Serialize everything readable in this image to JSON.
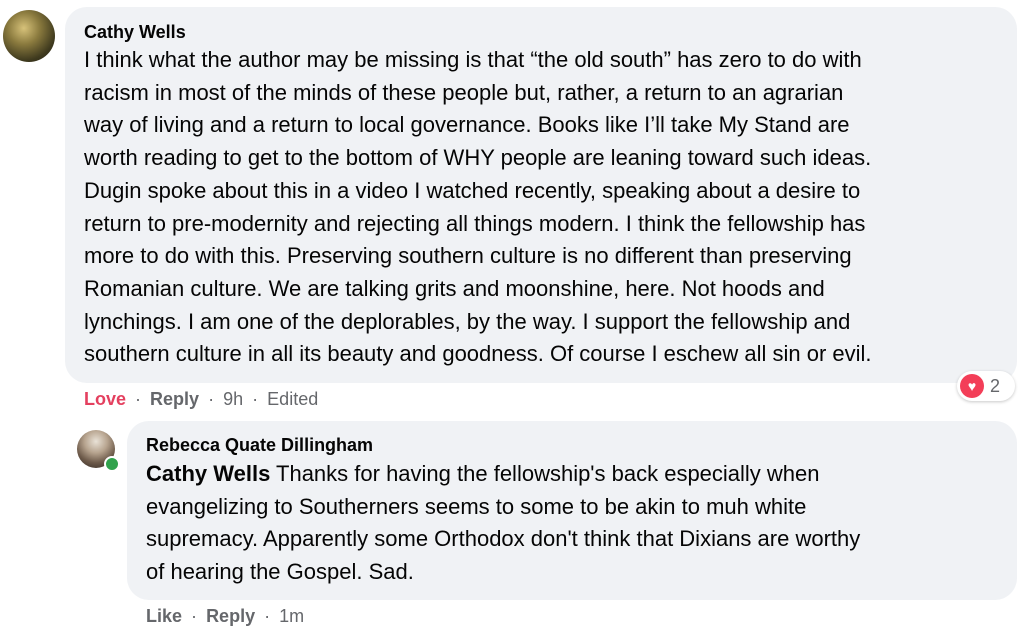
{
  "comment": {
    "author": "Cathy Wells",
    "lines": [
      "I think what the author may be missing is that “the old south” has zero to do with",
      "racism in most of the minds of these people but, rather, a return to an agrarian",
      "way of living and a return to local governance. Books like I’ll take My Stand are",
      "worth reading to get to the bottom of WHY people are leaning toward such ideas.",
      "Dugin spoke about this in a video I watched recently, speaking about a desire to",
      "return to pre-modernity and rejecting all things modern. I think the fellowship has",
      "more to do with this. Preserving southern culture is no different than preserving",
      "Romanian culture. We are talking grits and moonshine, here. Not hoods and",
      "lynchings. I am one of the deplorables, by the way. I support the fellowship and",
      "southern culture in all its beauty and goodness. Of course I eschew all sin or evil."
    ],
    "actions": {
      "love": "Love",
      "reply": "Reply",
      "time": "9h",
      "edited": "Edited",
      "separator": "·"
    },
    "reactions": {
      "icon": "heart-icon",
      "count": "2",
      "color": "#f33e58"
    }
  },
  "reply": {
    "author": "Rebecca Quate Dillingham",
    "mention": "Cathy Wells",
    "lines": [
      " Thanks for having the fellowship's back especially when",
      "evangelizing to Southerners seems to some to be akin to muh white",
      "supremacy. Apparently some Orthodox don't think that Dixians are worthy",
      "of hearing the Gospel. Sad."
    ],
    "online": true,
    "actions": {
      "like": "Like",
      "reply": "Reply",
      "time": "1m",
      "separator": "·"
    }
  },
  "colors": {
    "bubble": "#f0f2f5",
    "love": "#e4405f",
    "meta": "#65676b",
    "online": "#31a24c"
  }
}
